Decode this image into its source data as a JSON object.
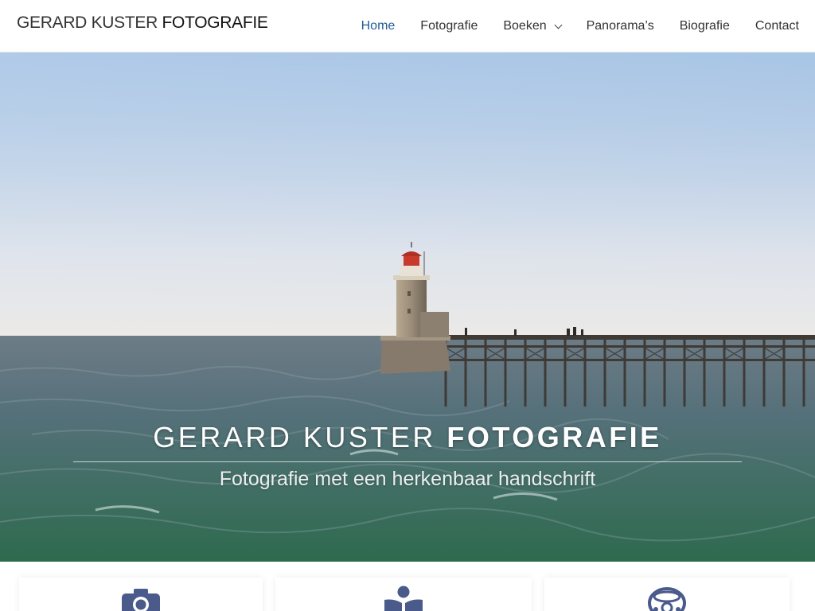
{
  "brand": {
    "logo_light": "GERARD KUSTER",
    "logo_bold": "FOTOGRAFIE"
  },
  "nav": {
    "items": [
      {
        "label": "Home",
        "active": true
      },
      {
        "label": "Fotografie",
        "active": false
      },
      {
        "label": "Boeken",
        "active": false,
        "has_dropdown": true
      },
      {
        "label": "Panorama’s",
        "active": false
      },
      {
        "label": "Biografie",
        "active": false
      },
      {
        "label": "Contact",
        "active": false
      }
    ]
  },
  "hero": {
    "title_light": "GERARD KUSTER",
    "title_bold": "FOTOGRAFIE",
    "subtitle": "Fotografie met een herkenbaar handschrift",
    "image": "lighthouse-pier-sea"
  },
  "features": [
    {
      "icon": "camera-icon"
    },
    {
      "icon": "book-reader-icon"
    },
    {
      "icon": "panorama-icon"
    }
  ],
  "colors": {
    "accent": "#1f5c99",
    "icon": "#4a5a8a"
  }
}
